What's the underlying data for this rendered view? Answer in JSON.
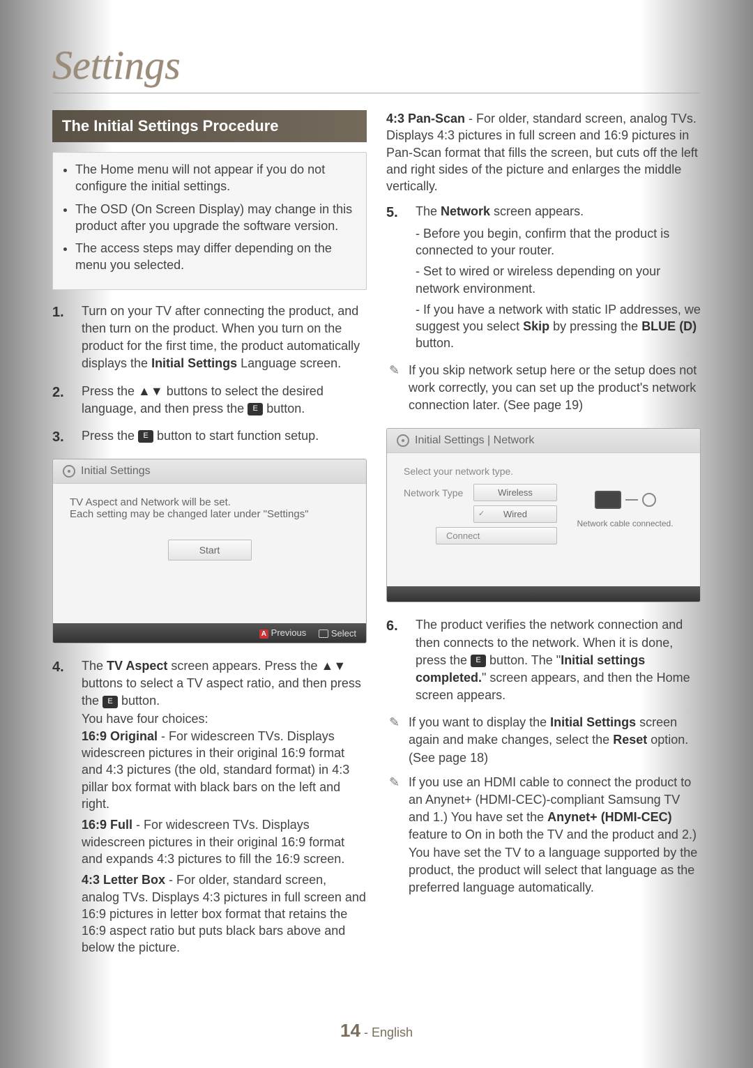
{
  "section_title": "Settings",
  "header_bar": "The Initial Settings Procedure",
  "notes": [
    "The Home menu will not appear if you do not configure the initial settings.",
    "The OSD (On Screen Display) may change in this product after you upgrade the software version.",
    "The access steps may differ depending on the menu you selected."
  ],
  "steps_left": {
    "s1": {
      "pre": "Turn on your TV after connecting the product, and then turn on the product. When you turn on the product for the first time, the product automatically displays the ",
      "bold": "Initial Settings",
      "post": " Language screen."
    },
    "s2": {
      "pre": "Press the ",
      "arrows": "▲▼",
      "mid": " buttons to select the desired language, and then press the ",
      "post": " button."
    },
    "s3": {
      "pre": "Press the ",
      "post": " button to start function setup."
    },
    "s4": {
      "line1_pre": "The ",
      "line1_bold": "TV Aspect",
      "line1_mid": " screen appears. Press the ",
      "line1_arrows": "▲▼",
      "line1_post": " buttons to select a TV aspect ratio, and then press the ",
      "line1_end": " button.",
      "choices_intro": "You have four choices:",
      "opt1_bold": "16:9 Original",
      "opt1": " - For widescreen TVs. Displays widescreen pictures in their original 16:9 format and 4:3 pictures (the old, standard format) in 4:3 pillar box format with black bars on the left and right.",
      "opt2_bold": "16:9 Full",
      "opt2": " - For widescreen TVs. Displays widescreen pictures in their original 16:9 format and expands 4:3 pictures to fill the 16:9 screen.",
      "opt3_bold": "4:3 Letter Box",
      "opt3": " - For older, standard screen, analog TVs. Displays 4:3 pictures in full screen and 16:9 pictures in letter box format that retains the 16:9 aspect ratio but puts black bars above and below the picture.",
      "opt4_bold": "4:3 Pan-Scan",
      "opt4": " - For older, standard screen, analog TVs. Displays 4:3 pictures in full screen and 16:9 pictures in Pan-Scan format that fills the screen, but cuts off the left and right sides of the picture and enlarges the middle vertically."
    },
    "s5": {
      "pre": "The ",
      "bold": "Network",
      "post": " screen appears.",
      "sub1": "- Before you begin, confirm that the product is connected to your router.",
      "sub2": "- Set to wired or wireless depending on your network environment.",
      "sub3_pre": "- If you have a network with static IP addresses, we suggest you select ",
      "sub3_bold1": "Skip",
      "sub3_mid": " by pressing the ",
      "sub3_bold2": "BLUE (D)",
      "sub3_post": " button."
    },
    "note5": "If you skip network setup here or the setup does not work correctly, you can set up the product's network connection later. (See page 19)",
    "s6": {
      "pre": "The product verifies the network connection and then connects to the network. When it is done, press the ",
      "mid": " button. The \"",
      "bold": "Initial settings completed.",
      "post": "\" screen appears, and then the Home screen appears."
    }
  },
  "note6_a": {
    "pre": "If you want to display the ",
    "bold": "Initial Settings",
    "mid": " screen again and make changes, select the ",
    "bold2": "Reset",
    "post": " option. (See page 18)"
  },
  "note6_b": {
    "pre": "If you use an HDMI cable to connect the product to an Anynet+ (HDMI-CEC)-compliant Samsung TV and 1.) You have set the ",
    "bold": "Anynet+ (HDMI-CEC)",
    "post": " feature to On in both the TV and the product and 2.) You have set the TV to a language supported by the product, the product will select that language as the preferred language automatically."
  },
  "osd1": {
    "title": "Initial Settings",
    "line1": "TV Aspect and Network will be set.",
    "line2": "Each setting may be changed later under \"Settings\"",
    "start": "Start",
    "prev_label": "Previous",
    "select_label": "Select",
    "btn_a": "A"
  },
  "osd2": {
    "title": "Initial Settings | Network",
    "prompt": "Select your network type.",
    "type_label": "Network Type",
    "wireless": "Wireless",
    "wired": "Wired",
    "connect": "Connect",
    "status": "Network cable connected."
  },
  "footer": {
    "num": "14",
    "lang": "English"
  }
}
